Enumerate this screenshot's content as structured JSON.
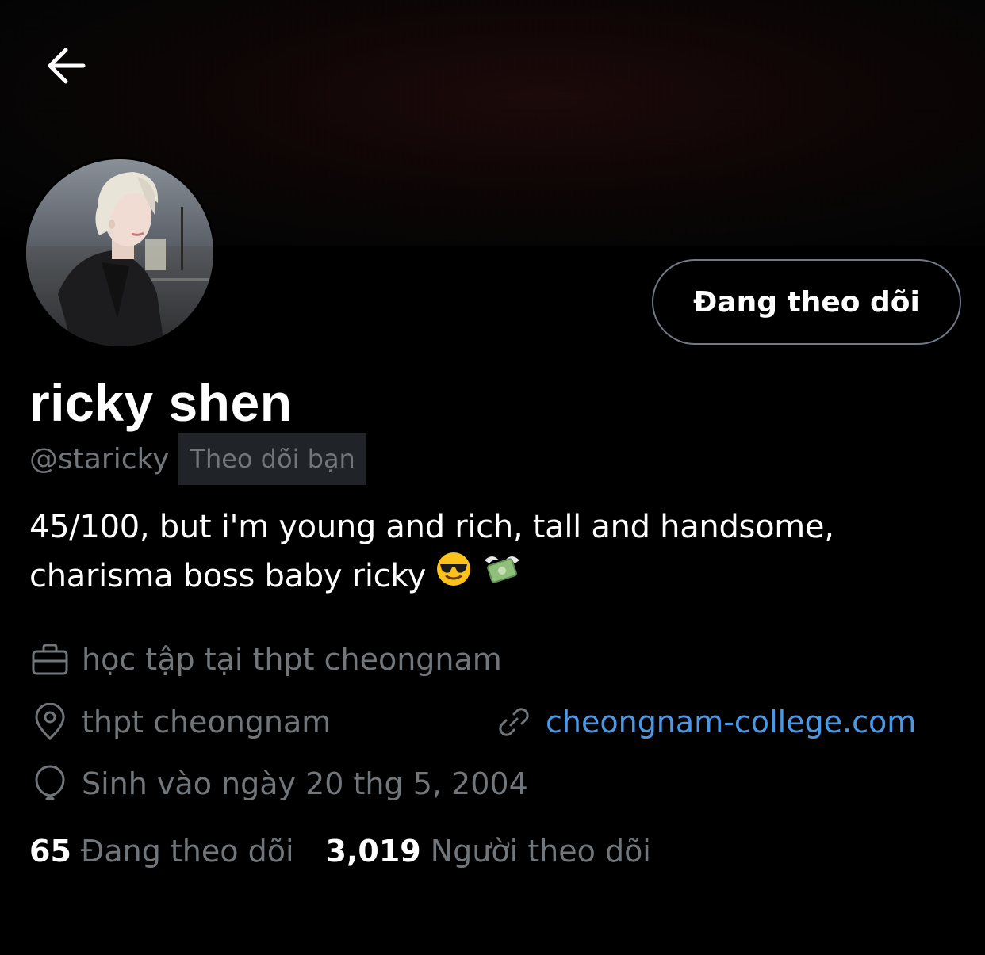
{
  "header": {
    "back_icon": "arrow-left-icon"
  },
  "profile": {
    "display_name": "ricky shen",
    "handle": "@staricky",
    "follows_you_badge": "Theo dõi bạn",
    "follow_button_label": "Đang theo dõi",
    "bio_line1": "45/100, but i'm young and rich, tall and handsome,",
    "bio_line2": "charisma boss baby ricky",
    "bio_emojis": [
      "smiling-face-with-sunglasses",
      "money-with-wings"
    ]
  },
  "meta": {
    "work": {
      "icon": "briefcase-icon",
      "text": "học tập tại thpt cheongnam"
    },
    "location": {
      "icon": "location-pin-icon",
      "text": "thpt cheongnam"
    },
    "website": {
      "icon": "link-icon",
      "text": "cheongnam-college.com"
    },
    "birthday": {
      "icon": "balloon-icon",
      "text": "Sinh vào ngày 20 thg 5, 2004"
    }
  },
  "stats": {
    "following_count": "65",
    "following_label": "Đang theo dõi",
    "followers_count": "3,019",
    "followers_label": "Người theo dõi"
  },
  "colors": {
    "background": "#000000",
    "text_primary": "#ffffff",
    "text_secondary": "#71767b",
    "link": "#4a99e9",
    "badge_bg": "#202327",
    "button_border": "#6e7a86"
  }
}
